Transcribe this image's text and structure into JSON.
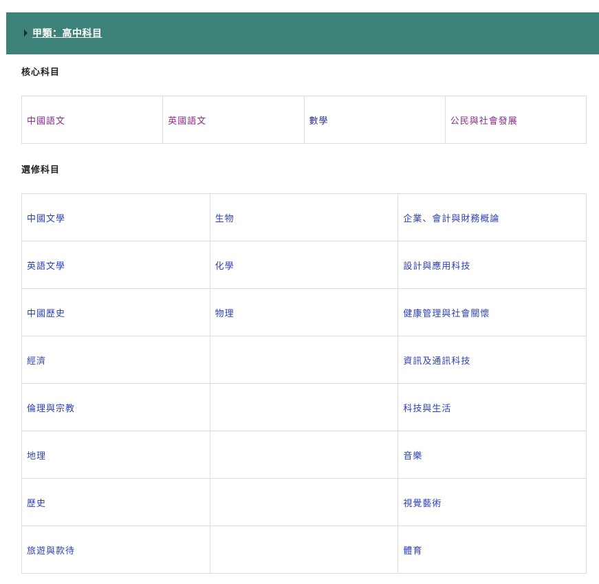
{
  "header": {
    "title": "甲類：高中科目"
  },
  "core": {
    "heading": "核心科目",
    "subjects": [
      "中國語文",
      "英國語文",
      "數學",
      "公民與社會發展"
    ]
  },
  "elective": {
    "heading": "選修科目",
    "rows": [
      [
        "中國文學",
        "生物",
        "企業、會計與財務概論"
      ],
      [
        "英語文學",
        "化學",
        "設計與應用科技"
      ],
      [
        "中國歷史",
        "物理",
        "健康管理與社會關懷"
      ],
      [
        "經濟",
        "",
        "資訊及通訊科技"
      ],
      [
        "倫理與宗教",
        "",
        "科技與生活"
      ],
      [
        "地理",
        "",
        "音樂"
      ],
      [
        "歷史",
        "",
        "視覺藝術"
      ],
      [
        "旅遊與款待",
        "",
        "體育"
      ]
    ]
  },
  "colors": {
    "header_bg": "#3d8279",
    "visited_link": "#8a2b8a",
    "link": "#2a3fb8"
  }
}
